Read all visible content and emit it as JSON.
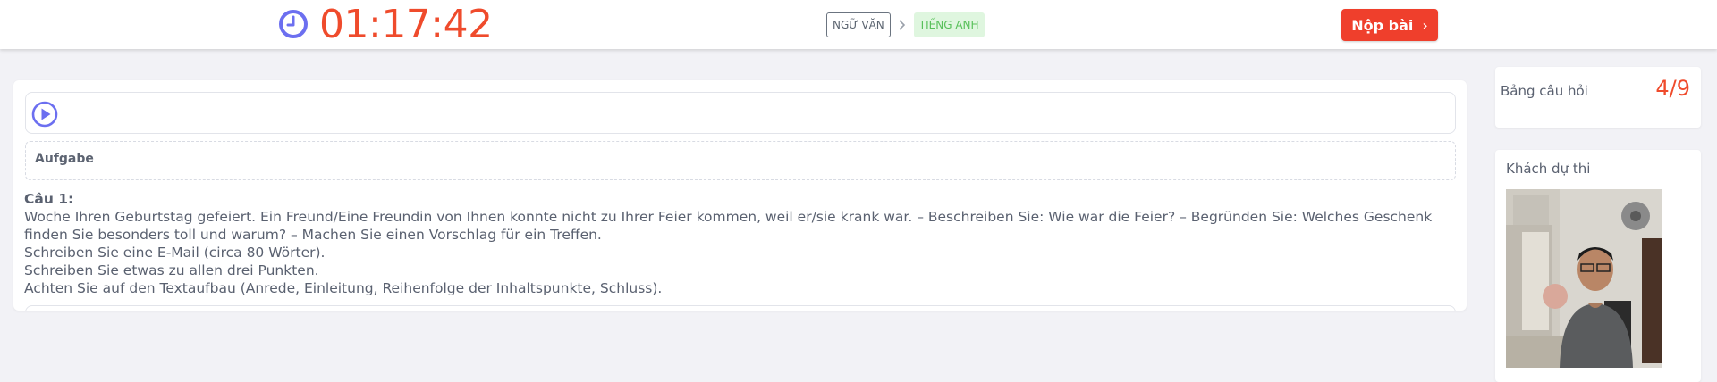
{
  "header": {
    "timer": "01:17:42",
    "subjects": [
      "NGỮ VĂN",
      "TIẾNG ANH"
    ],
    "submit_label": "Nộp bài"
  },
  "main": {
    "section_title": "Aufgabe",
    "question": {
      "number": "Câu 1:",
      "lines": [
        "Woche Ihren Geburtstag gefeiert. Ein Freund/Eine Freundin von Ihnen konnte nicht zu Ihrer Feier kommen, weil er/sie krank war. – Beschreiben Sie: Wie war die Feier? – Begründen Sie: Welches Geschenk finden Sie besonders toll und warum? – Machen Sie einen Vorschlag für ein Treffen.",
        "Schreiben Sie eine E-Mail (circa 80 Wörter).",
        "Schreiben Sie etwas zu allen drei Punkten.",
        "Achten Sie auf den Textaufbau (Anrede, Einleitung, Reihenfolge der Inhaltspunkte, Schluss)."
      ]
    }
  },
  "sidebar": {
    "question_board_label": "Bảng câu hỏi",
    "question_progress": "4/9",
    "candidate_label": "Khách dự thi"
  },
  "colors": {
    "accent_red": "#ef4b2c",
    "timer_icon": "#6c6ff0",
    "subject_active_bg": "#dff6df",
    "subject_active_text": "#58c05a"
  },
  "icons": [
    "clock-icon",
    "chevron-right-icon",
    "play-icon"
  ]
}
